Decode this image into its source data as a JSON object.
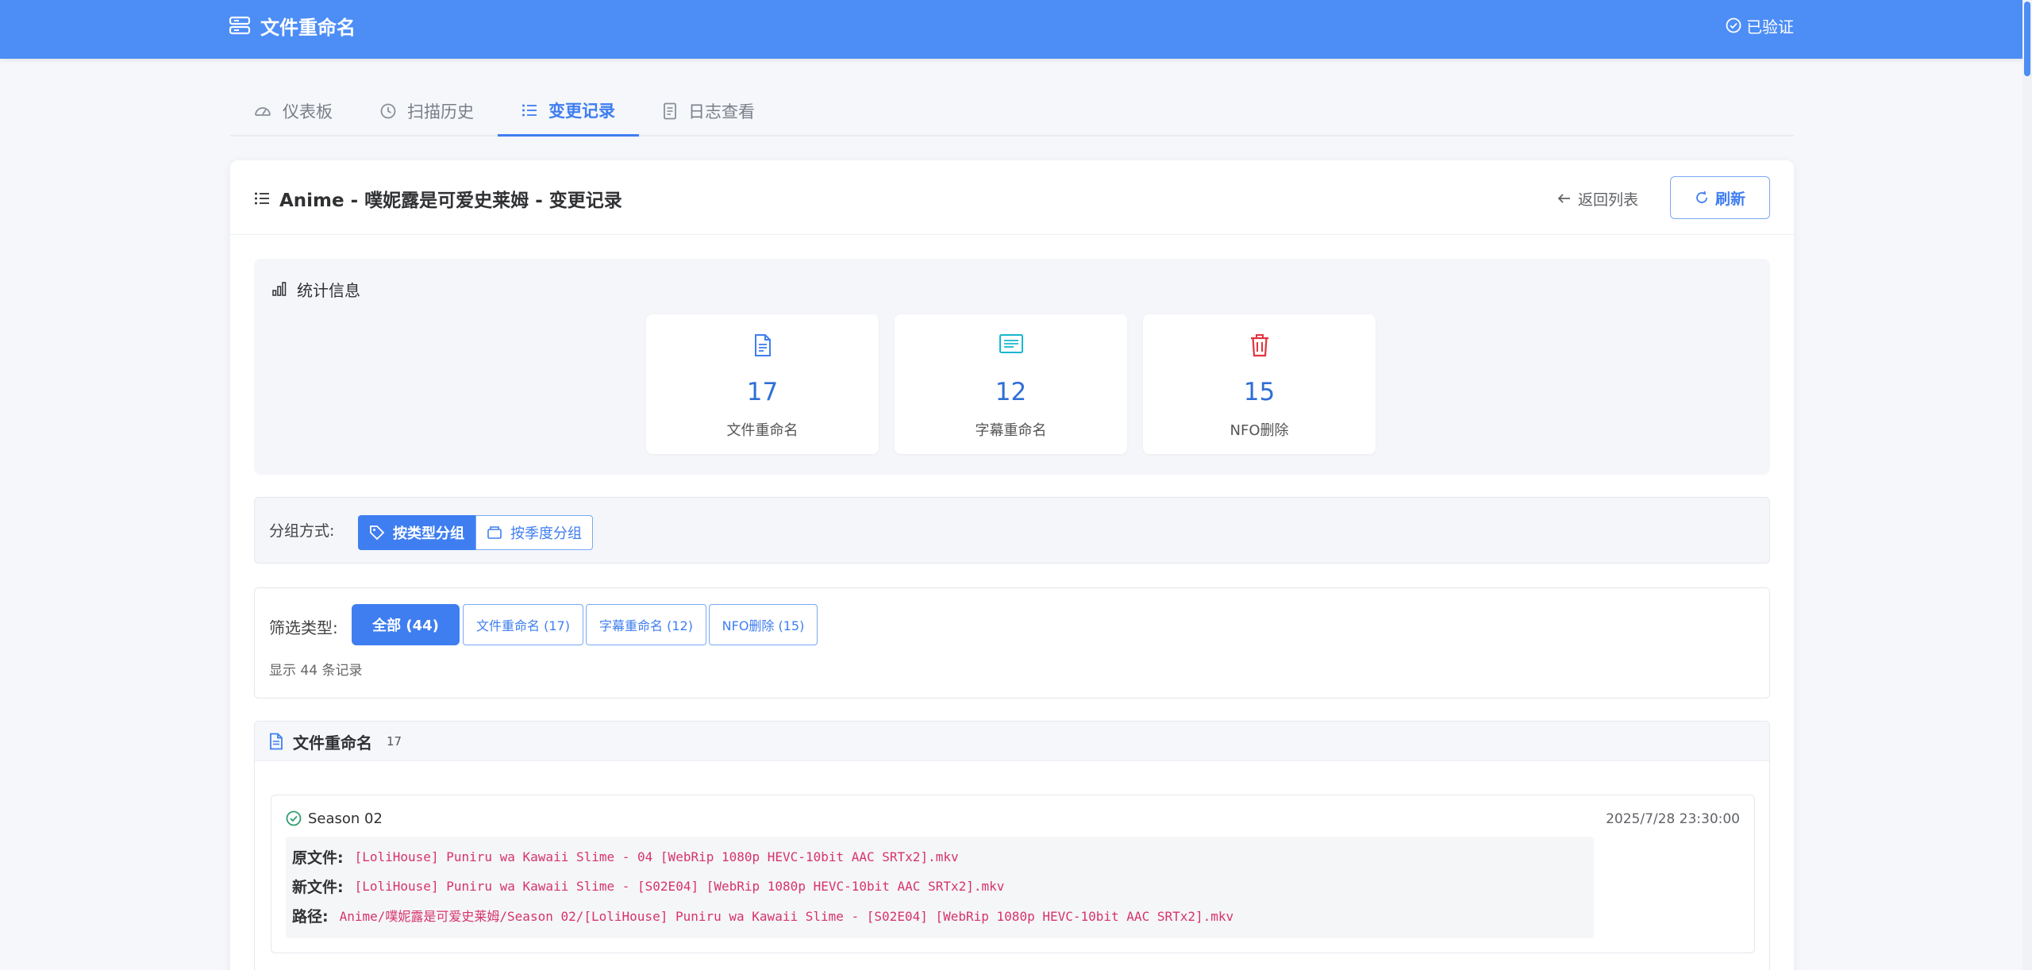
{
  "header": {
    "title": "文件重命名",
    "verified_label": "已验证"
  },
  "tabs": [
    {
      "label": "仪表板",
      "icon": "dashboard-icon"
    },
    {
      "label": "扫描历史",
      "icon": "clock-icon"
    },
    {
      "label": "变更记录",
      "icon": "list-icon",
      "active": true
    },
    {
      "label": "日志查看",
      "icon": "document-icon"
    }
  ],
  "card": {
    "title": "Anime - 噗妮露是可爱史莱姆 - 变更记录",
    "back_label": "返回列表",
    "refresh_label": "刷新"
  },
  "stats": {
    "title": "统计信息",
    "items": [
      {
        "value": "17",
        "label": "文件重命名",
        "icon": "file-icon",
        "color": "#3f7ef0"
      },
      {
        "value": "12",
        "label": "字幕重命名",
        "icon": "subtitle-icon",
        "color": "#17b8d0"
      },
      {
        "value": "15",
        "label": "NFO删除",
        "icon": "trash-icon",
        "color": "#e0343f"
      }
    ]
  },
  "grouping": {
    "label": "分组方式:",
    "by_type": "按类型分组",
    "by_season": "按季度分组"
  },
  "filter": {
    "label": "筛选类型:",
    "buttons": [
      {
        "label": "全部 (44)",
        "active": true
      },
      {
        "label": "文件重命名 (17)"
      },
      {
        "label": "字幕重命名 (12)"
      },
      {
        "label": "NFO删除 (15)"
      }
    ],
    "count_text": "显示 44 条记录"
  },
  "section": {
    "title": "文件重命名",
    "count": "17",
    "records": [
      {
        "season": "Season 02",
        "time": "2025/7/28 23:30:00",
        "original_key": "原文件:",
        "original_value": "[LoliHouse] Puniru wa Kawaii Slime - 04 [WebRip 1080p HEVC-10bit AAC SRTx2].mkv",
        "new_key": "新文件:",
        "new_value": "[LoliHouse] Puniru wa Kawaii Slime - [S02E04] [WebRip 1080p HEVC-10bit AAC SRTx2].mkv",
        "path_key": "路径:",
        "path_value": "Anime/噗妮露是可爱史莱姆/Season 02/[LoliHouse] Puniru wa Kawaii Slime - [S02E04] [WebRip 1080p HEVC-10bit AAC SRTx2].mkv"
      }
    ]
  },
  "colors": {
    "primary": "#4c8df6",
    "accent": "#3f7ef0",
    "code": "#d6336c",
    "danger": "#e0343f",
    "info": "#17b8d0"
  }
}
